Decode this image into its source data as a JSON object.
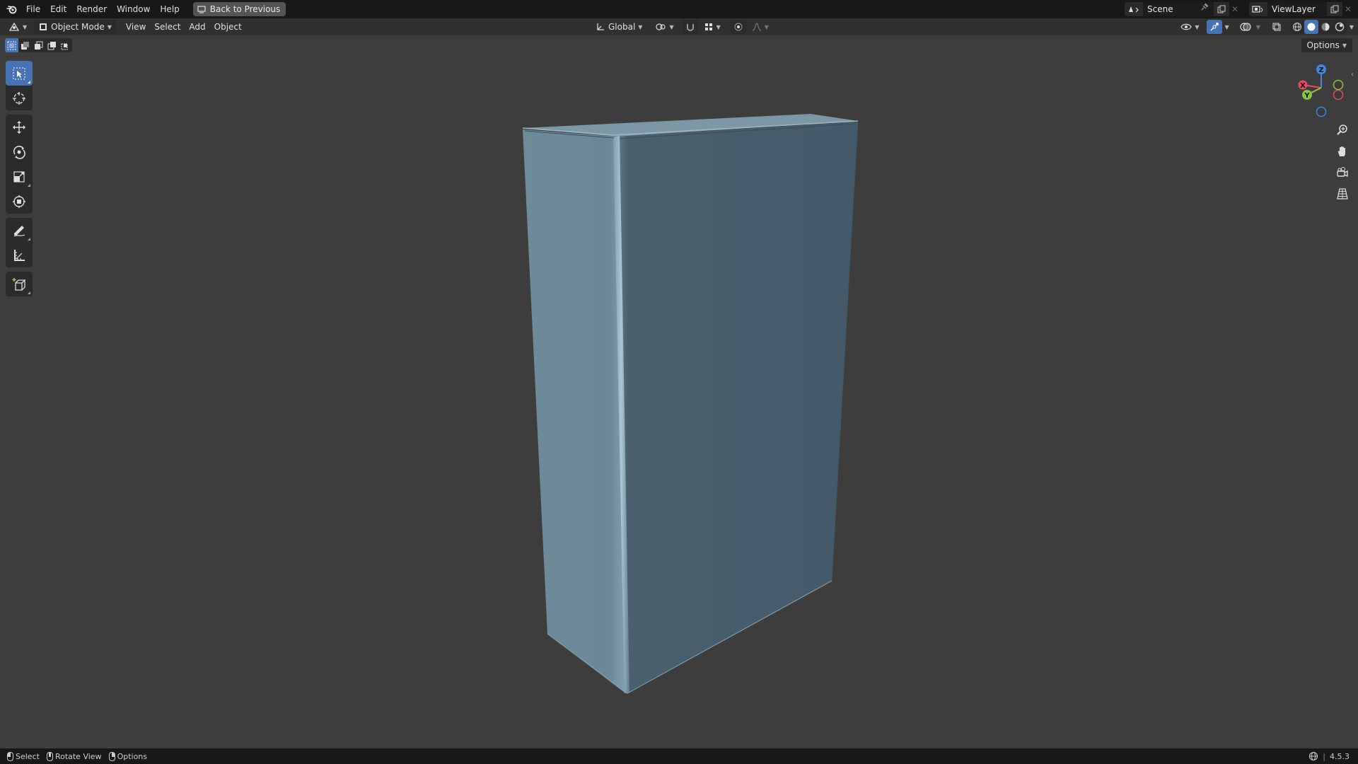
{
  "menu": {
    "items": [
      "File",
      "Edit",
      "Render",
      "Window",
      "Help"
    ],
    "back_label": "Back to Previous"
  },
  "scene": {
    "name": "Scene",
    "view_layer": "ViewLayer"
  },
  "header": {
    "mode": "Object Mode",
    "menus": [
      "View",
      "Select",
      "Add",
      "Object"
    ],
    "transform_orientation": "Global",
    "options_label": "Options"
  },
  "gizmo": {
    "z": "Z",
    "x": "X",
    "y": "Y"
  },
  "statusbar": {
    "select": "Select",
    "rotate": "Rotate View",
    "options": "Options",
    "version": "4.5.3"
  },
  "colors": {
    "accent": "#4772b3",
    "axis_x": "#e84a5f",
    "axis_y": "#8cc63f",
    "axis_z": "#3f87e3",
    "object_light": "#6f8c9b",
    "object_dark": "#485d6b"
  }
}
